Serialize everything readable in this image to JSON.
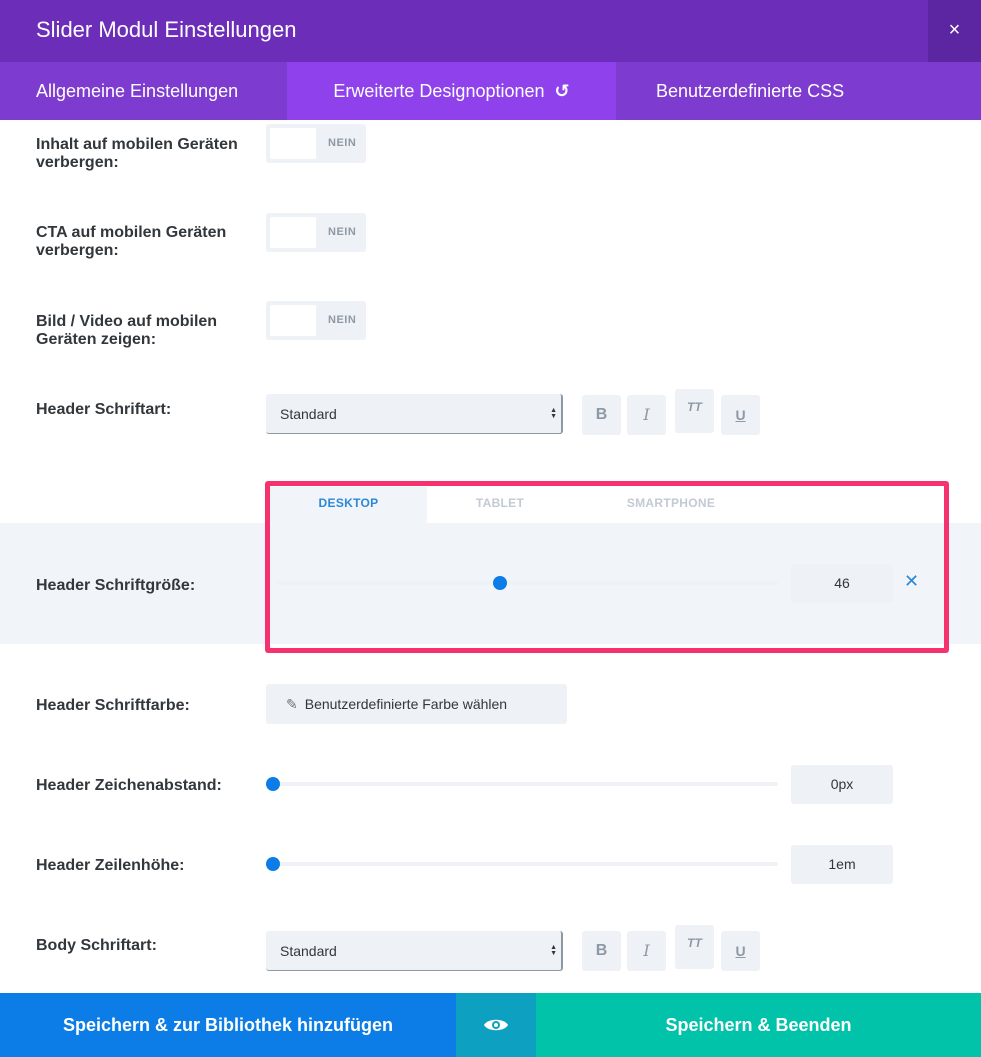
{
  "modal": {
    "title": "Slider Modul Einstellungen",
    "close_icon": "×"
  },
  "tabs": [
    {
      "label": "Allgemeine Einstellungen"
    },
    {
      "label": "Erweiterte Designoptionen",
      "icon": "↺"
    },
    {
      "label": "Benutzerdefinierte CSS"
    }
  ],
  "settings": {
    "hide_content_mobile": {
      "label": "Inhalt auf mobilen Geräten verbergen:",
      "value": "NEIN"
    },
    "hide_cta_mobile": {
      "label": "CTA auf mobilen Geräten verbergen:",
      "value": "NEIN"
    },
    "show_media_mobile": {
      "label": "Bild / Video auf mobilen Geräten zeigen:",
      "value": "NEIN"
    },
    "header_font": {
      "label": "Header Schriftart:",
      "value": "Standard"
    },
    "header_font_size": {
      "label": "Header Schriftgröße:",
      "value": "46",
      "reset_icon": "✕"
    },
    "header_font_color": {
      "label": "Header Schriftfarbe:",
      "button_label": "Benutzerdefinierte Farbe wählen"
    },
    "header_letter_spacing": {
      "label": "Header Zeichenabstand:",
      "value": "0px"
    },
    "header_line_height": {
      "label": "Header Zeilenhöhe:",
      "value": "1em"
    },
    "body_font": {
      "label": "Body Schriftart:",
      "value": "Standard"
    }
  },
  "responsive_tabs": {
    "desktop": "DESKTOP",
    "tablet": "TABLET",
    "smartphone": "SMARTPHONE"
  },
  "format_buttons": {
    "bold": "B",
    "italic": "I",
    "caps": "TT",
    "underline": "U"
  },
  "footer": {
    "save_library": "Speichern & zur Bibliothek hinzufügen",
    "save_exit": "Speichern & Beenden"
  },
  "icons": {
    "close": "close-icon",
    "reset": "undo-icon",
    "picker": "eyedropper-icon",
    "preview": "eye-icon"
  },
  "colors": {
    "title_bar": "#6c2eb9",
    "tab_bar": "#7e3bd0",
    "active_tab": "#8f42ec",
    "accent_blue": "#0c7ce6",
    "highlight": "#f6326e",
    "save_green": "#00c3aa"
  }
}
